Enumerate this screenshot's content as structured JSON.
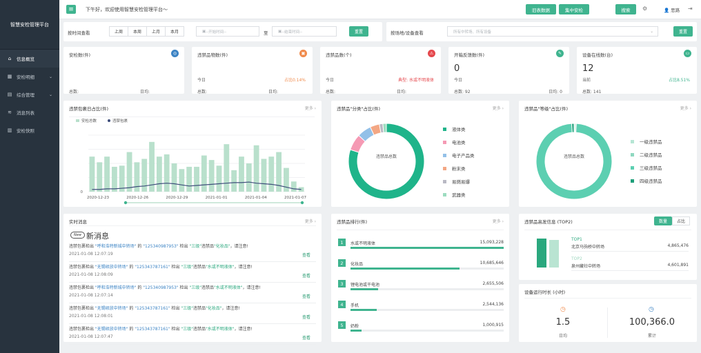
{
  "app": {
    "title": "智慧安检管理平台"
  },
  "sidebar": {
    "items": [
      {
        "label": "信息概览",
        "icon": "home-icon",
        "active": true
      },
      {
        "label": "安检明细",
        "icon": "grid-icon",
        "expand": true
      },
      {
        "label": "综合管理",
        "icon": "list-icon",
        "expand": true
      },
      {
        "label": "消息列表",
        "icon": "layers-icon"
      },
      {
        "label": "安检快照",
        "icon": "bar-chart-icon"
      }
    ]
  },
  "topbar": {
    "greeting": "下午好，欢迎使用智慧安检管理平台～",
    "old_data": "旧表数据",
    "center": "集中安检",
    "search": "搜索",
    "user": "思路"
  },
  "filter": {
    "time_label": "按时间查看",
    "segments": [
      "上周",
      "本周",
      "上月",
      "本月"
    ],
    "start_placeholder": "--开始时间--",
    "to": "至",
    "end_placeholder": "--结束时间--",
    "reset": "重置",
    "site_label": "按场地/设备查看",
    "site_placeholder": "所有中转场、所有设备",
    "reset2": "重置"
  },
  "kpis": [
    {
      "title": "安检数(件)",
      "value": "",
      "sub": "",
      "right": "",
      "foot_left": "总数:",
      "foot_right": "日均:",
      "icon_color": "#3b83c4",
      "icon": "globe-icon"
    },
    {
      "title": "违禁品物数(件)",
      "value": "",
      "sub": "今日",
      "right": "占比0.14%",
      "foot_left": "总数:",
      "foot_right": "日均:",
      "icon_color": "#f08a4b",
      "icon": "box-icon",
      "right_color": "#f08a4b"
    },
    {
      "title": "违禁品数(个)",
      "value": "",
      "sub": "今日",
      "right": "典型: 水或不明液体",
      "foot_left": "总数:",
      "foot_right": "日均:",
      "icon_color": "#e5484d",
      "icon": "warning-icon",
      "right_color": "#e5484d"
    },
    {
      "title": "开箱反馈数(件)",
      "value": "0",
      "sub": "今日",
      "right": "",
      "foot_left": "总数: 92",
      "foot_right": "日均: 0",
      "icon_color": "#3fb48f",
      "icon": "edit-icon"
    },
    {
      "title": "设备在线数(台)",
      "value": "12",
      "sub": "当前",
      "right": "占比8.51%",
      "foot_left": "总数: 141",
      "foot_right": "",
      "icon_color": "#3fb48f",
      "icon": "monitor-icon",
      "right_color": "#3fb48f"
    }
  ],
  "cards": {
    "daily": {
      "title": "违禁包裹日占比(件)",
      "more": "更多 ›",
      "legend": [
        "安检总数",
        "违禁包裹"
      ]
    },
    "category": {
      "title": "违禁品\"分类\"占比(件)",
      "more": "更多 ›",
      "center": "违禁品总数",
      "legend": [
        "液体类",
        "电池类",
        "电子产品类",
        "粉末类",
        "易燃易爆",
        "武器类"
      ]
    },
    "level": {
      "title": "违禁品\"等级\"占比(件)",
      "more": "更多 ›",
      "center": "违禁品总数",
      "legend": [
        "一级违禁品",
        "二级违禁品",
        "三级违禁品",
        "四级违禁品"
      ]
    },
    "messages": {
      "title": "实时消息",
      "more": "更多 ›",
      "new_badge": "New",
      "new_title": "新消息",
      "view": "查看"
    },
    "ranking": {
      "title": "违禁品排行(件)",
      "more": "更多 ›"
    },
    "top2": {
      "title": "违禁品高发信息 (TOP2)",
      "tab_count": "数量",
      "tab_ratio": "占比"
    },
    "runtime": {
      "title": "设备运行时长 (小时)",
      "daily_value": "1.5",
      "daily_label": "日均",
      "total_value": "100,366.0",
      "total_label": "累计"
    }
  },
  "messages": [
    {
      "p1": "违禁包裹检出 ",
      "site": "\"呼和浩特新城中转场\"",
      "p2": " 的 ",
      "code": "\"125340987953\"",
      "p3": "  检出 ",
      "level": "\"三级\"",
      "p4": "违禁品",
      "item": "\"化妆品\"",
      "p5": "，请注意!",
      "time": "2021-01-08 12:07:19"
    },
    {
      "p1": "违禁包裹检出 ",
      "site": "\"无锡硕放中转场\"",
      "p2": " 的 ",
      "code": "\"125343787161\"",
      "p3": "  检出 ",
      "level": "\"三级\"",
      "p4": "违禁品",
      "item": "\"水或不明液体\"",
      "p5": "，请注意!",
      "time": "2021-01-08 12:08:09"
    },
    {
      "p1": "违禁包裹检出 ",
      "site": "\"呼和浩特新城中转场\"",
      "p2": " 的 ",
      "code": "\"125340987953\"",
      "p3": "  检出 ",
      "level": "\"三级\"",
      "p4": "违禁品",
      "item": "\"水或不明液体\"",
      "p5": "，请注意!",
      "time": "2021-01-08 12:07:14"
    },
    {
      "p1": "违禁包裹检出 ",
      "site": "\"无锡硕放中转场\"",
      "p2": " 的 ",
      "code": "\"125343787161\"",
      "p3": "  检出 ",
      "level": "\"三级\"",
      "p4": "违禁品",
      "item": "\"化妆品\"",
      "p5": "，请注意!",
      "time": "2021-01-08 12:08:01"
    },
    {
      "p1": "违禁包裹检出 ",
      "site": "\"无锡硕放中转场\"",
      "p2": " 的 ",
      "code": "\"125343787161\"",
      "p3": "  检出 ",
      "level": "\"三级\"",
      "p4": "违禁品",
      "item": "\"水或不明液体\"",
      "p5": "，请注意!",
      "time": "2021-01-08 12:07:47"
    }
  ],
  "ranking": [
    {
      "rank": "1",
      "name": "水或不明液体",
      "value": "15,093,228",
      "share": 1.0
    },
    {
      "rank": "2",
      "name": "化妆品",
      "value": "10,685,646",
      "share": 0.71
    },
    {
      "rank": "3",
      "name": "锂电池或干电池",
      "value": "2,655,506",
      "share": 0.18
    },
    {
      "rank": "4",
      "name": "手机",
      "value": "2,544,136",
      "share": 0.17
    },
    {
      "rank": "5",
      "name": "奶粉",
      "value": "1,000,915",
      "share": 0.07
    }
  ],
  "top2": [
    {
      "tag": "TOP1",
      "site": "北京马驹桥中转场",
      "value": "4,865,476",
      "share": 1.0
    },
    {
      "tag": "TOP2",
      "site": "泉州藏社中转场",
      "value": "4,601,891",
      "share": 0.946
    }
  ],
  "colors": {
    "accent": "#3fb48f",
    "bar": "#b9e0cc",
    "line": "#3d4d7a"
  },
  "chart_data": [
    {
      "type": "bar",
      "title": "违禁包裹日占比(件)",
      "x_ticks": [
        "2020-12-23",
        "2020-12-26",
        "2020-12-29",
        "2021-01-01",
        "2021-01-04",
        "2021-01-07"
      ],
      "y_ticks": [
        "0"
      ],
      "series": [
        {
          "name": "安检总数",
          "values": [
            0.62,
            0.52,
            0.62,
            0.44,
            0.46,
            0.7,
            0.52,
            0.58,
            0.88,
            0.62,
            0.66,
            0.5,
            0.4,
            0.44,
            0.44,
            0.64,
            0.56,
            0.46,
            0.84,
            0.38,
            0.62,
            0.5,
            0.82,
            0.58,
            0.62,
            0.7,
            0.42,
            0.18,
            0.08
          ]
        },
        {
          "name": "违禁包裹",
          "values": [
            0.04,
            0.04,
            0.05,
            0.05,
            0.06,
            0.07,
            0.09,
            0.1,
            0.12,
            0.14,
            0.15,
            0.14,
            0.12,
            0.1,
            0.11,
            0.12,
            0.13,
            0.14,
            0.15,
            0.16,
            0.16,
            0.17,
            0.15,
            0.14,
            0.13,
            0.11,
            0.08,
            0.05,
            0.04
          ]
        }
      ],
      "note": "values are relative to the chart's full height; the numeric y-tick labels are illegible"
    },
    {
      "type": "pie",
      "title": "违禁品\"分类\"占比(件)",
      "labels": [
        "液体类",
        "电池类",
        "电子产品类",
        "粉末类",
        "易燃易爆",
        "武器类"
      ],
      "values": [
        80,
        7,
        6,
        4,
        1.5,
        1.5
      ],
      "colors": [
        "#1fb48a",
        "#f59ab4",
        "#93c0e8",
        "#f3a784",
        "#b9b9c4",
        "#9ddcc0"
      ]
    },
    {
      "type": "pie",
      "title": "违禁品\"等级\"占比(件)",
      "labels": [
        "一级违禁品",
        "二级违禁品",
        "三级违禁品",
        "四级违禁品"
      ],
      "values": [
        0.5,
        0.5,
        98,
        1
      ],
      "colors": [
        "#b6e6d4",
        "#8fd8c0",
        "#5ccfb1",
        "#1f9f7a"
      ]
    }
  ]
}
